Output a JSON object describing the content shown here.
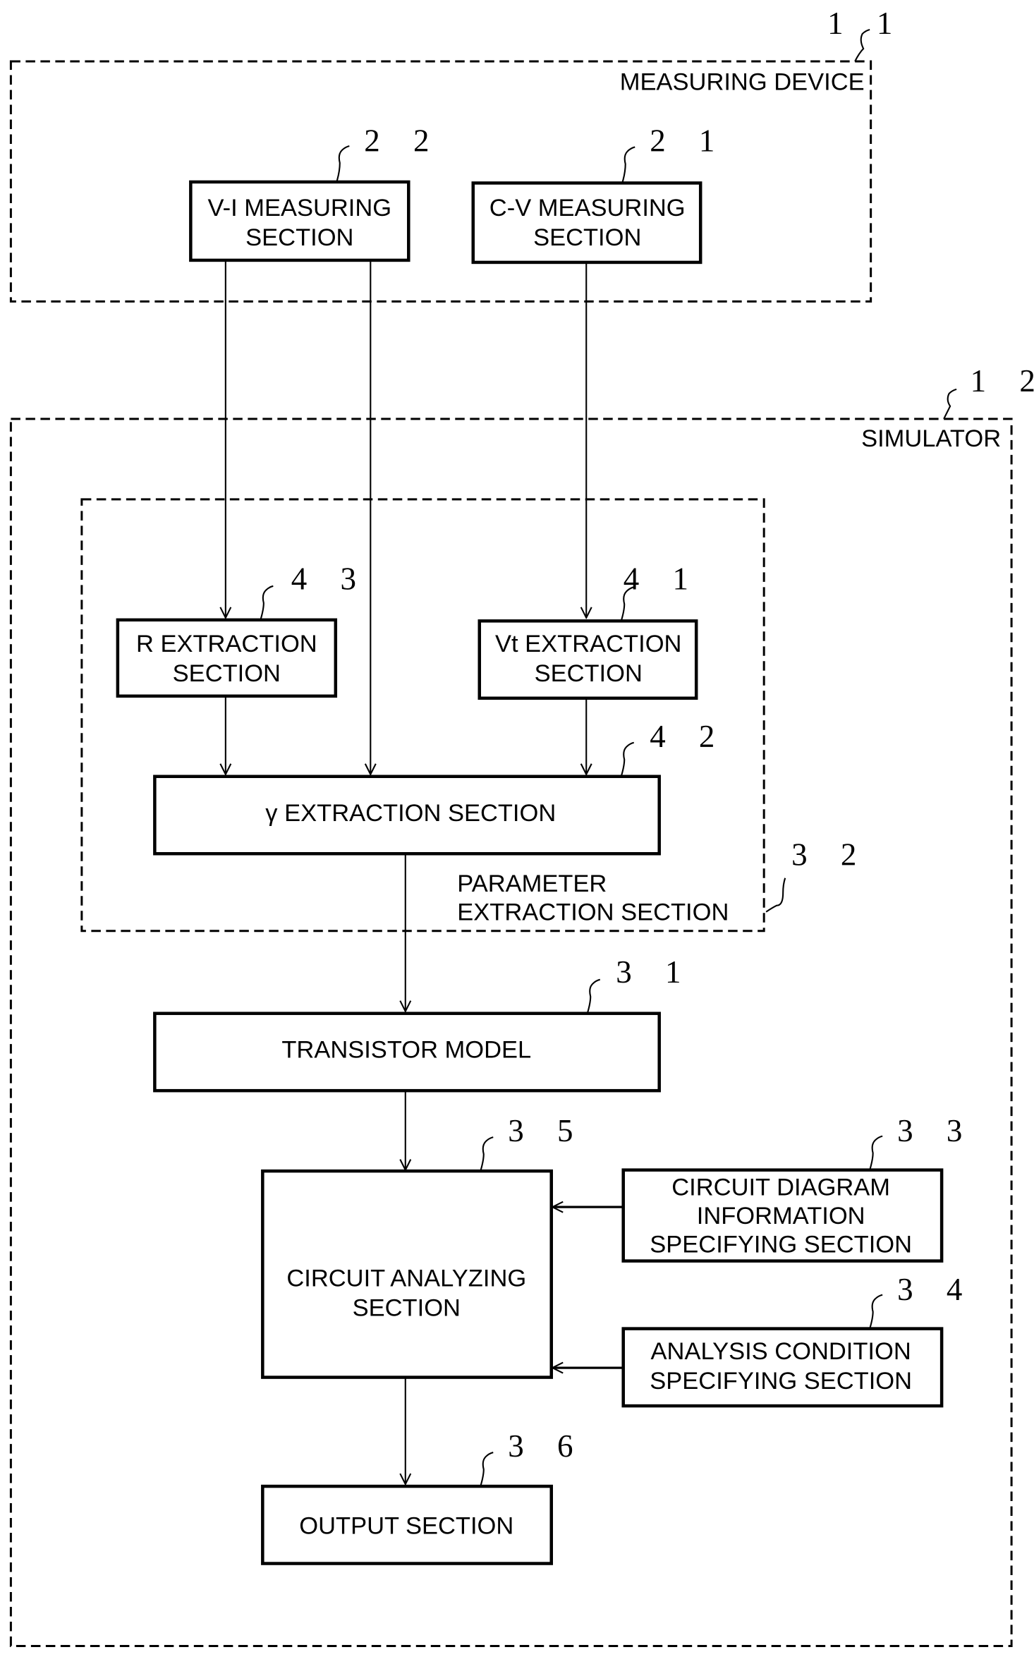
{
  "diagram": {
    "groups": {
      "measuring_device": {
        "label": "MEASURING DEVICE",
        "ref": "1 1"
      },
      "simulator": {
        "label": "SIMULATOR",
        "ref": "1 2"
      },
      "parameter_extraction": {
        "label_line1": "PARAMETER",
        "label_line2": "EXTRACTION SECTION",
        "ref": "3 2"
      }
    },
    "blocks": {
      "vi": {
        "line1": "V-I MEASURING",
        "line2": "SECTION",
        "ref": "2 2"
      },
      "cv": {
        "line1": "C-V MEASURING",
        "line2": "SECTION",
        "ref": "2 1"
      },
      "r": {
        "line1": "R EXTRACTION",
        "line2": "SECTION",
        "ref": "4 3"
      },
      "vt": {
        "line1": "Vt EXTRACTION",
        "line2": "SECTION",
        "ref": "4 1"
      },
      "gamma": {
        "line1": "γ EXTRACTION SECTION",
        "ref": "4 2"
      },
      "transistor": {
        "line1": "TRANSISTOR MODEL",
        "ref": "3 1"
      },
      "circuit_analyzing": {
        "line1": "CIRCUIT ANALYZING",
        "line2": "SECTION",
        "ref": "3 5"
      },
      "circuit_diagram": {
        "line1": "CIRCUIT DIAGRAM",
        "line2": "INFORMATION",
        "line3": "SPECIFYING SECTION",
        "ref": "3 3"
      },
      "analysis_condition": {
        "line1": "ANALYSIS CONDITION",
        "line2": "SPECIFYING SECTION",
        "ref": "3 4"
      },
      "output": {
        "line1": "OUTPUT SECTION",
        "ref": "3 6"
      }
    },
    "connections": [
      {
        "from": "V-I MEASURING SECTION",
        "to": "R EXTRACTION SECTION"
      },
      {
        "from": "V-I MEASURING SECTION",
        "to": "γ EXTRACTION SECTION"
      },
      {
        "from": "C-V MEASURING SECTION",
        "to": "Vt EXTRACTION SECTION"
      },
      {
        "from": "R EXTRACTION SECTION",
        "to": "γ EXTRACTION SECTION"
      },
      {
        "from": "Vt EXTRACTION SECTION",
        "to": "γ EXTRACTION SECTION"
      },
      {
        "from": "γ EXTRACTION SECTION",
        "to": "TRANSISTOR MODEL"
      },
      {
        "from": "TRANSISTOR MODEL",
        "to": "CIRCUIT ANALYZING SECTION"
      },
      {
        "from": "CIRCUIT DIAGRAM INFORMATION SPECIFYING SECTION",
        "to": "CIRCUIT ANALYZING SECTION"
      },
      {
        "from": "ANALYSIS CONDITION SPECIFYING SECTION",
        "to": "CIRCUIT ANALYZING SECTION"
      },
      {
        "from": "CIRCUIT ANALYZING SECTION",
        "to": "OUTPUT SECTION"
      }
    ]
  }
}
